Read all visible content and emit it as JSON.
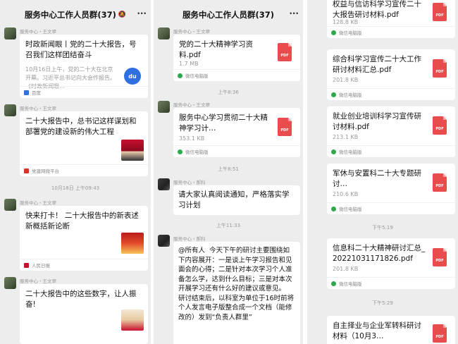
{
  "chat_title": "服务中心工作人员群(37)",
  "more_label": "···",
  "pdf_label": "PDF",
  "panel1": {
    "m1": {
      "sender": "服务中心・王文翠",
      "title": "时政新闻眼丨党的二十大报告，号召我们这样团结奋斗",
      "sub": "10月16日上午，党的二十大在北京开幕。习近平总书记向大会作报告。《时政新闻眼…",
      "source": "百度",
      "thumb": "du"
    },
    "m2": {
      "sender": "服务中心・王文翠",
      "title": "二十大报告中，总书记这样谋划和部署党的建设新的伟大工程",
      "source": "党建网微平台"
    },
    "time1": "10月18日 上午09:43",
    "m3": {
      "sender": "服务中心・王文翠",
      "title": "快来打卡！ 二十大报告中的新表述新概括新论断",
      "source": "人民日报"
    },
    "m4": {
      "sender": "服务中心・王文翠",
      "title": "二十大报告中的这些数字，让人振奋!"
    }
  },
  "panel2": {
    "m1": {
      "sender": "服务中心・王文翠",
      "title": "党的二十大精神学习资料.pdf",
      "size": "1.7 MB",
      "source": "微信电脑版"
    },
    "time1": "上午8:36",
    "m2": {
      "sender": "服务中心・王文翠",
      "title": "服务中心学习贯彻二十大精神学习计…",
      "size": "353.1 KB",
      "source": "微信电脑版"
    },
    "time2": "上午8:51",
    "m3": {
      "sender": "服务中心・郝科",
      "text": "请大家认真阅读通知，严格落实学习计划"
    },
    "time3": "上午11:33",
    "m4": {
      "sender": "服务中心・郝科",
      "text": "@所有人  今天下午的研讨主要围绕如下内容展开：一是谈上午学习报告和见面会的心得；二是针对本次学习个人准备怎么学，达到什么目标；三是对本次开展学习还有什么好的建议或意见。\n研讨结束后，以科室为单位于16时前将个人发言电子版整合成一个文档（能修改的）发到“负责人群里”"
    }
  },
  "panel3": {
    "f1": {
      "title": "权益与信访科学习宣传二十大报告研讨材料.pdf",
      "size": "128.8 KB",
      "source": "微信电脑版"
    },
    "f2": {
      "title": "综合科学习宣传二十大工作研讨材料汇总.pdf",
      "size": "201.8 KB",
      "source": "微信电脑版"
    },
    "f3": {
      "title": "就业创业培训科学习宣传研讨材料.pdf",
      "size": "213.1 KB",
      "source": "微信电脑版"
    },
    "f4": {
      "title": "军休与安置科二十大专题研讨…",
      "size": "210.6 KB",
      "source": "微信电脑版"
    },
    "time1": "下午5:19",
    "f5": {
      "title": "信息科二十大精神研讨汇总_20221031171826.pdf",
      "size": "201.8 KB",
      "source": "微信电脑版"
    },
    "time2": "下午5:29",
    "f6": {
      "title": "自主择业与企业军转科研讨材料（10月3…"
    }
  },
  "colors": {
    "background": "#ededed",
    "bubble": "#ffffff",
    "pdf_red": "#e84c4c",
    "source_green": "#2fa84f"
  },
  "icons": [
    "avatar",
    "pdf-icon",
    "wechat-pc-icon",
    "baidu-icon",
    "more-icon"
  ]
}
